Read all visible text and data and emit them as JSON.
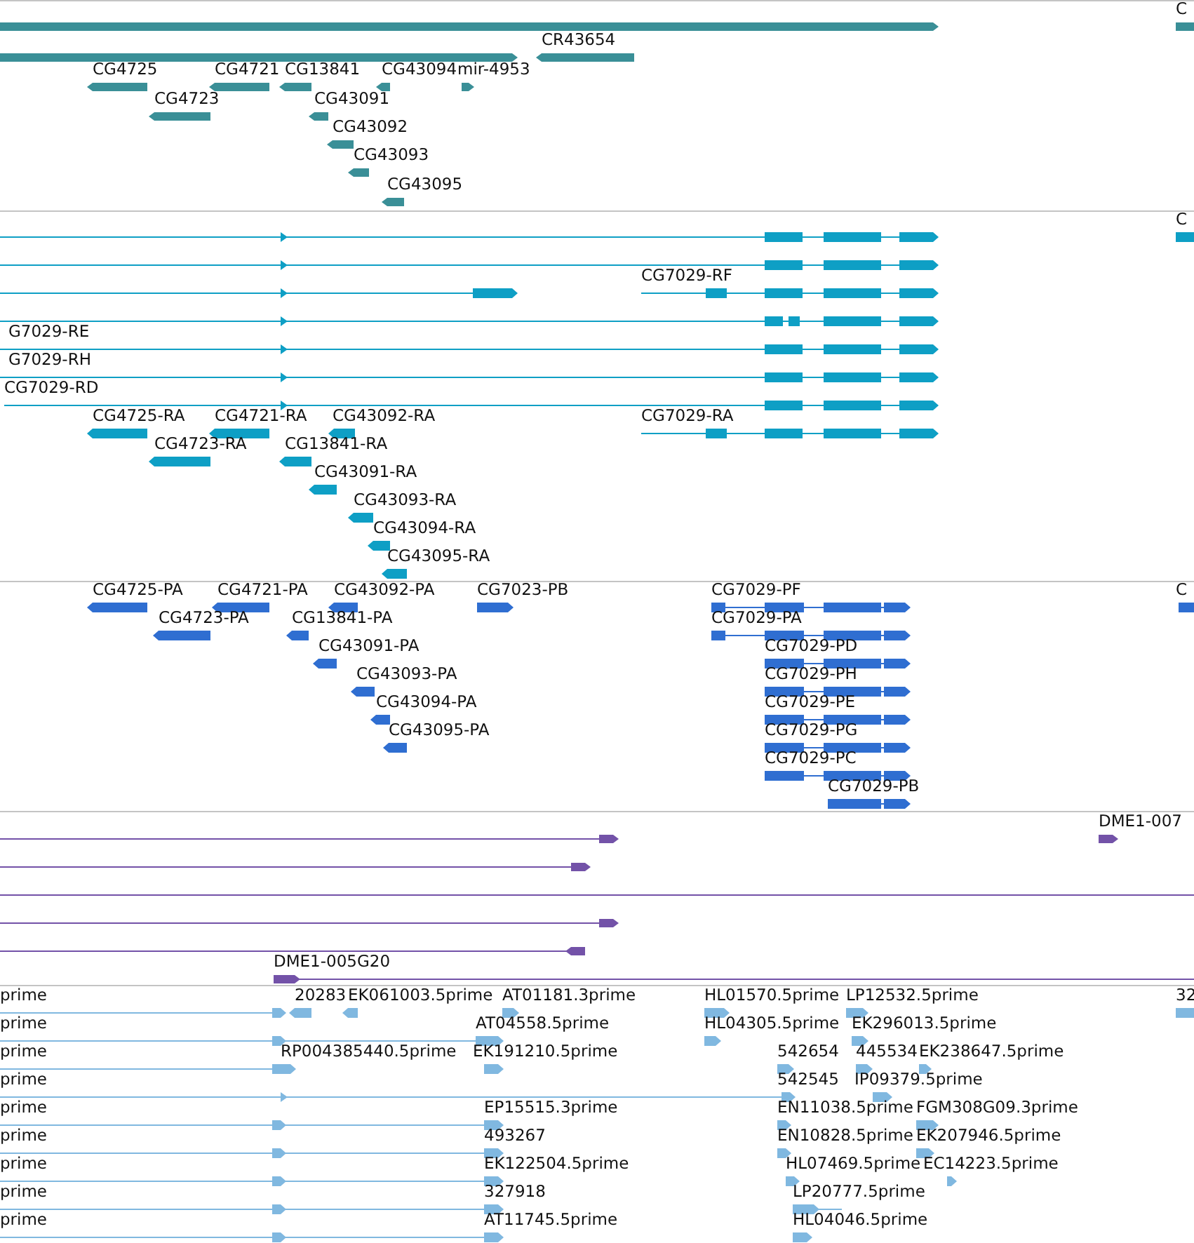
{
  "tracks": [
    {
      "kind": "gene",
      "color": "#3a8f97",
      "features": [
        {
          "reverse": false
        },
        {
          "label": "C",
          "reverse": false
        },
        {
          "reverse": false
        },
        {
          "label": "CR43654",
          "reverse": true
        },
        {
          "label": "CG4725",
          "reverse": true
        },
        {
          "label": "CG4721",
          "reverse": true
        },
        {
          "label": "CG13841",
          "reverse": true
        },
        {
          "label": "CG43094",
          "reverse": true
        },
        {
          "label": "mir-4953",
          "reverse": false
        },
        {
          "label": "CG4723",
          "reverse": true
        },
        {
          "label": "CG43091",
          "reverse": true
        },
        {
          "label": "CG43092",
          "reverse": true
        },
        {
          "label": "CG43093",
          "reverse": true
        },
        {
          "label": "CG43095",
          "reverse": true
        }
      ]
    },
    {
      "kind": "transcript",
      "color": "#0e9fc5",
      "features": [
        {
          "reverse": false
        },
        {
          "reverse": false
        },
        {
          "reverse": false
        },
        {
          "label": "CG7029-RF",
          "reverse": false
        },
        {
          "reverse": false
        },
        {
          "label": "G7029-RE",
          "reverse": false
        },
        {
          "label": "G7029-RH",
          "reverse": false
        },
        {
          "label": "CG7029-RD",
          "reverse": false
        },
        {
          "label": "CG4725-RA",
          "reverse": true
        },
        {
          "label": "CG4721-RA",
          "reverse": true
        },
        {
          "label": "CG43092-RA",
          "reverse": true
        },
        {
          "label": "CG7029-RA",
          "reverse": false
        },
        {
          "label": "CG4723-RA",
          "reverse": true
        },
        {
          "label": "CG13841-RA",
          "reverse": true
        },
        {
          "label": "CG43091-RA",
          "reverse": true
        },
        {
          "label": "CG43093-RA",
          "reverse": true
        },
        {
          "label": "CG43094-RA",
          "reverse": true
        },
        {
          "label": "CG43095-RA",
          "reverse": true
        },
        {
          "label": "C",
          "reverse": false
        }
      ]
    },
    {
      "kind": "protein",
      "color": "#2f6ed1",
      "features": [
        {
          "label": "CG4725-PA",
          "reverse": true
        },
        {
          "label": "CG4721-PA",
          "reverse": true
        },
        {
          "label": "CG43092-PA",
          "reverse": true
        },
        {
          "label": "CG7023-PB",
          "reverse": false
        },
        {
          "label": "CG7029-PF",
          "reverse": false
        },
        {
          "label": "C",
          "reverse": false
        },
        {
          "label": "CG4723-PA",
          "reverse": true
        },
        {
          "label": "CG13841-PA",
          "reverse": true
        },
        {
          "label": "CG7029-PA",
          "reverse": false
        },
        {
          "label": "CG43091-PA",
          "reverse": true
        },
        {
          "label": "CG7029-PD",
          "reverse": false
        },
        {
          "label": "CG43093-PA",
          "reverse": true
        },
        {
          "label": "CG7029-PH",
          "reverse": false
        },
        {
          "label": "CG43094-PA",
          "reverse": true
        },
        {
          "label": "CG7029-PE",
          "reverse": false
        },
        {
          "label": "CG43095-PA",
          "reverse": true
        },
        {
          "label": "CG7029-PG",
          "reverse": false
        },
        {
          "label": "CG7029-PC",
          "reverse": false
        },
        {
          "label": "CG7029-PB",
          "reverse": false
        }
      ]
    },
    {
      "kind": "clone",
      "color": "#7352a8",
      "features": [
        {
          "kind": "clone",
          "reverse": false
        },
        {
          "kind": "clone",
          "reverse": false
        },
        {
          "kind": "span"
        },
        {
          "kind": "clone",
          "reverse": false
        },
        {
          "kind": "clone",
          "reverse": true
        },
        {
          "kind": "clone",
          "label": "DME1-005G20",
          "reverse": false
        },
        {
          "kind": "clone",
          "label": "DME1-007",
          "reverse": false
        }
      ]
    },
    {
      "kind": "est",
      "color": "#80b8e0",
      "features": [
        {
          "label": "prime",
          "reverse": false
        },
        {
          "label": "20283",
          "reverse": true
        },
        {
          "label": "EK061003.5prime",
          "reverse": true
        },
        {
          "label": "AT01181.3prime",
          "reverse": false
        },
        {
          "label": "HL01570.5prime",
          "reverse": false
        },
        {
          "label": "LP12532.5prime",
          "reverse": false
        },
        {
          "label": "32",
          "reverse": false
        },
        {
          "label": "prime",
          "reverse": false
        },
        {
          "label": "AT04558.5prime",
          "reverse": false
        },
        {
          "label": "HL04305.5prime",
          "reverse": false
        },
        {
          "label": "EK296013.5prime",
          "reverse": false
        },
        {
          "label": "prime",
          "reverse": false
        },
        {
          "label": "RP004385440.5prime",
          "reverse": false
        },
        {
          "label": "EK191210.5prime",
          "reverse": false
        },
        {
          "label": "542654",
          "reverse": false
        },
        {
          "label": "445534",
          "reverse": false
        },
        {
          "label": "EK238647.5prime",
          "reverse": false
        },
        {
          "label": "prime",
          "reverse": false
        },
        {
          "label": "542545",
          "reverse": false
        },
        {
          "label": "IP09379.5prime",
          "reverse": false
        },
        {
          "label": "prime",
          "reverse": false
        },
        {
          "label": "EP15515.3prime",
          "reverse": false
        },
        {
          "label": "EN11038.5prime",
          "reverse": false
        },
        {
          "label": "FGM308G09.3prime",
          "reverse": false
        },
        {
          "label": "prime",
          "reverse": false
        },
        {
          "label": "493267",
          "reverse": false
        },
        {
          "label": "EN10828.5prime",
          "reverse": false
        },
        {
          "label": "EK207946.5prime",
          "reverse": false
        },
        {
          "label": "prime",
          "reverse": false
        },
        {
          "label": "EK122504.5prime",
          "reverse": false
        },
        {
          "label": "HL07469.5prime",
          "reverse": false
        },
        {
          "label": "EC14223.5prime",
          "reverse": false
        },
        {
          "label": "prime",
          "reverse": false
        },
        {
          "label": "327918",
          "reverse": false
        },
        {
          "label": "LP20777.5prime",
          "reverse": false
        },
        {
          "label": "prime",
          "reverse": false
        },
        {
          "label": "AT11745.5prime",
          "reverse": false
        },
        {
          "label": "HL04046.5prime",
          "reverse": false
        }
      ]
    }
  ]
}
